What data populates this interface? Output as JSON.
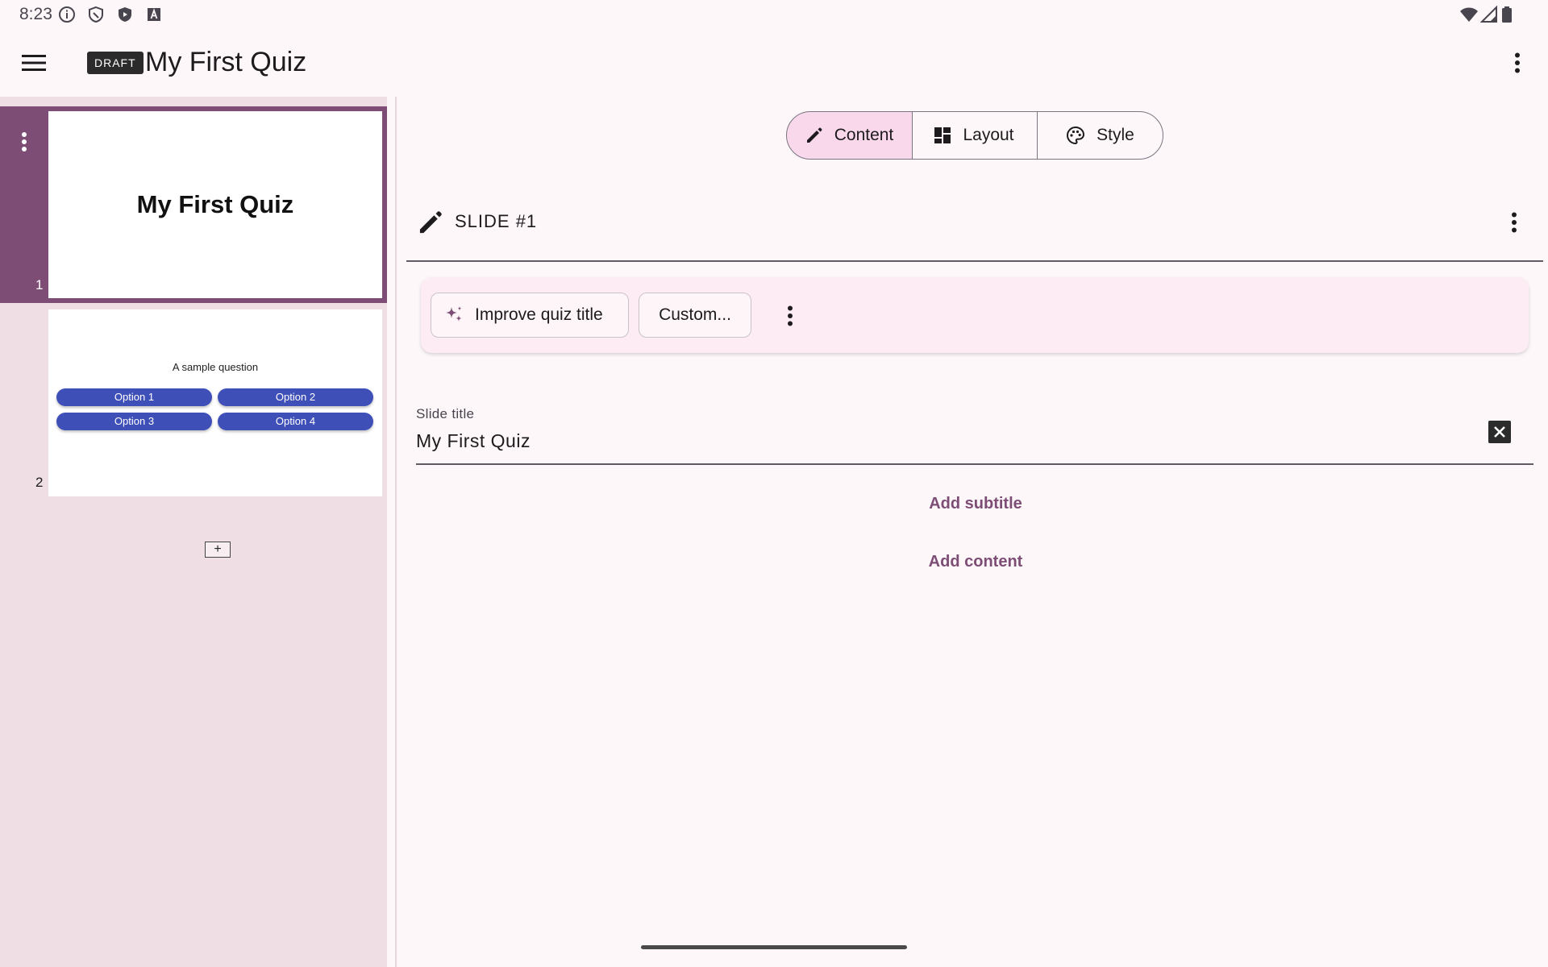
{
  "status_bar": {
    "time": "8:23",
    "left_icons": [
      "info-icon",
      "shield-outline-icon",
      "shield-play-icon",
      "font-a-icon"
    ],
    "right_icons": [
      "wifi-icon",
      "signal-icon",
      "battery-icon"
    ]
  },
  "app_bar": {
    "badge": "DRAFT",
    "title": "My First Quiz"
  },
  "slides": [
    {
      "number": "1",
      "title": "My First Quiz",
      "selected": true
    },
    {
      "number": "2",
      "question": "A sample question",
      "options": [
        "Option 1",
        "Option 2",
        "Option 3",
        "Option 4"
      ]
    }
  ],
  "sidebar": {
    "add_slide_label": "+"
  },
  "tabs": [
    {
      "label": "Content",
      "icon": "pencil-icon",
      "selected": true
    },
    {
      "label": "Layout",
      "icon": "dashboard-icon",
      "selected": false
    },
    {
      "label": "Style",
      "icon": "palette-icon",
      "selected": false
    }
  ],
  "editor": {
    "slide_heading": "SLIDE #1",
    "ai_actions": {
      "improve_label": "Improve quiz title",
      "custom_label": "Custom..."
    },
    "slide_title_field": {
      "label": "Slide title",
      "value": "My First Quiz"
    },
    "add_subtitle": "Add subtitle",
    "add_content": "Add content"
  },
  "colors": {
    "accent": "#7d4d75",
    "selected_tab_bg": "#f9d8ec",
    "option_button": "#3f4fb8",
    "sidebar_bg": "#efdfe5"
  }
}
